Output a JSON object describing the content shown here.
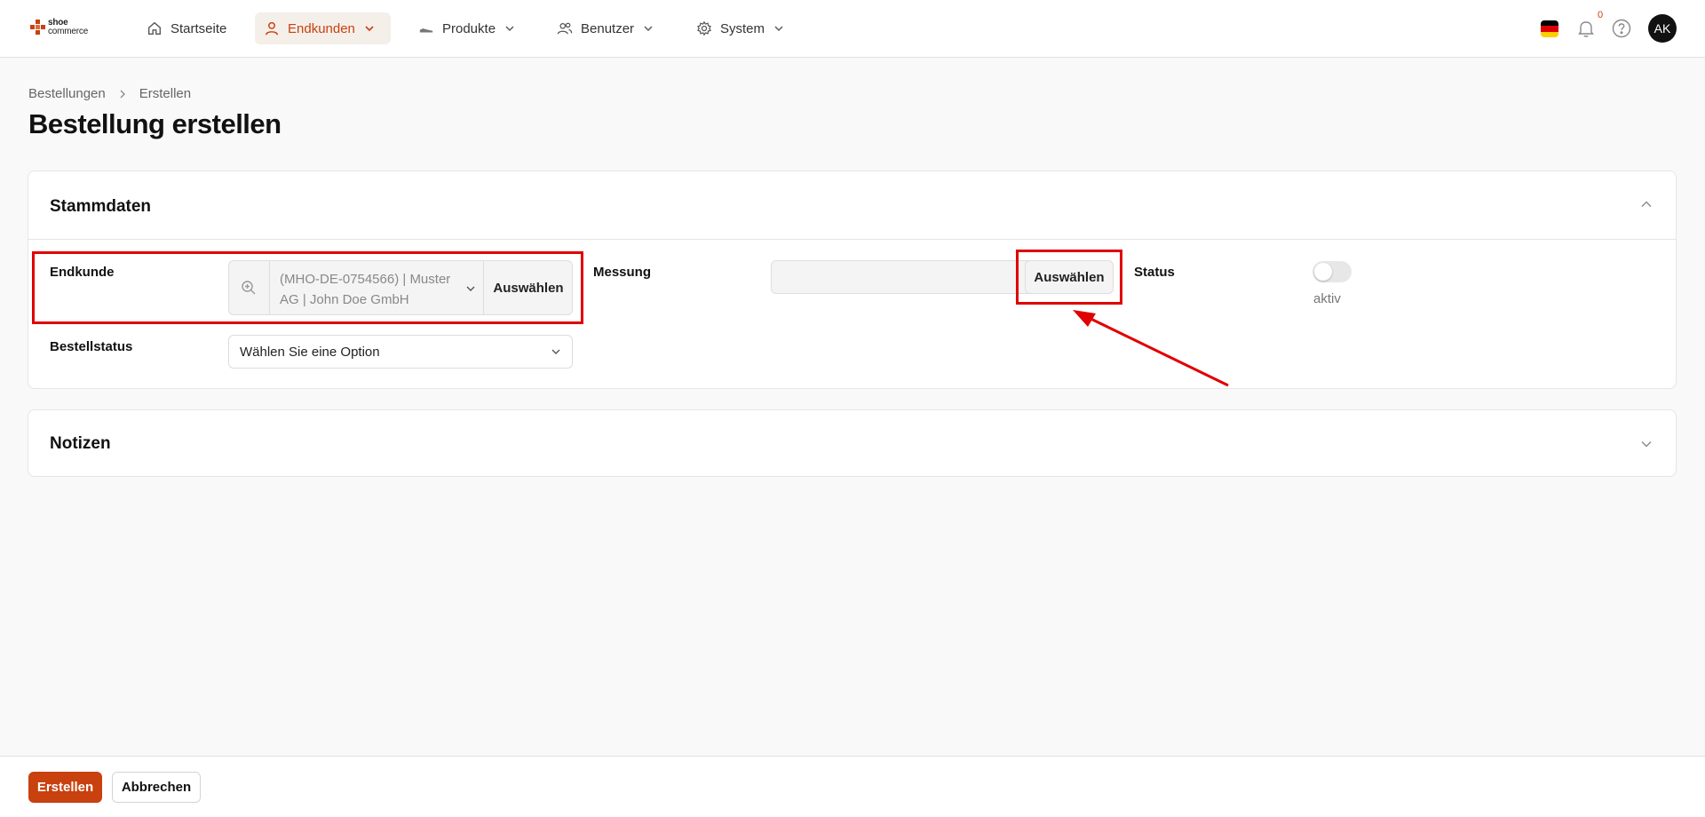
{
  "brand": {
    "line1": "shoe",
    "line2": "commerce",
    "accent": "#c8410f"
  },
  "nav": {
    "items": [
      {
        "label": "Startseite",
        "icon": "home-icon"
      },
      {
        "label": "Endkunden",
        "icon": "user-icon",
        "active": true
      },
      {
        "label": "Produkte",
        "icon": "shoe-icon"
      },
      {
        "label": "Benutzer",
        "icon": "users-icon"
      },
      {
        "label": "System",
        "icon": "gear-icon"
      }
    ],
    "notifications_count": "0",
    "avatar_initials": "AK",
    "language_flag": "flag-de"
  },
  "breadcrumb": {
    "parent": "Bestellungen",
    "current": "Erstellen"
  },
  "page": {
    "title": "Bestellung erstellen"
  },
  "stammdaten": {
    "title": "Stammdaten",
    "endkunde_label": "Endkunde",
    "endkunde_value_line1": "(MHO-DE-0754566) | Muster",
    "endkunde_value_line2": "AG | John Doe GmbH",
    "endkunde_button": "Auswählen",
    "messung_label": "Messung",
    "messung_value": "",
    "messung_button": "Auswählen",
    "status_label": "Status",
    "status_toggle_text": "aktiv",
    "status_active": false,
    "bestellstatus_label": "Bestellstatus",
    "bestellstatus_value": "Wählen Sie eine Option"
  },
  "notizen": {
    "title": "Notizen"
  },
  "footer": {
    "create_label": "Erstellen",
    "cancel_label": "Abbrechen"
  },
  "colors": {
    "annotation": "#e00000",
    "primary": "#c8410f"
  }
}
